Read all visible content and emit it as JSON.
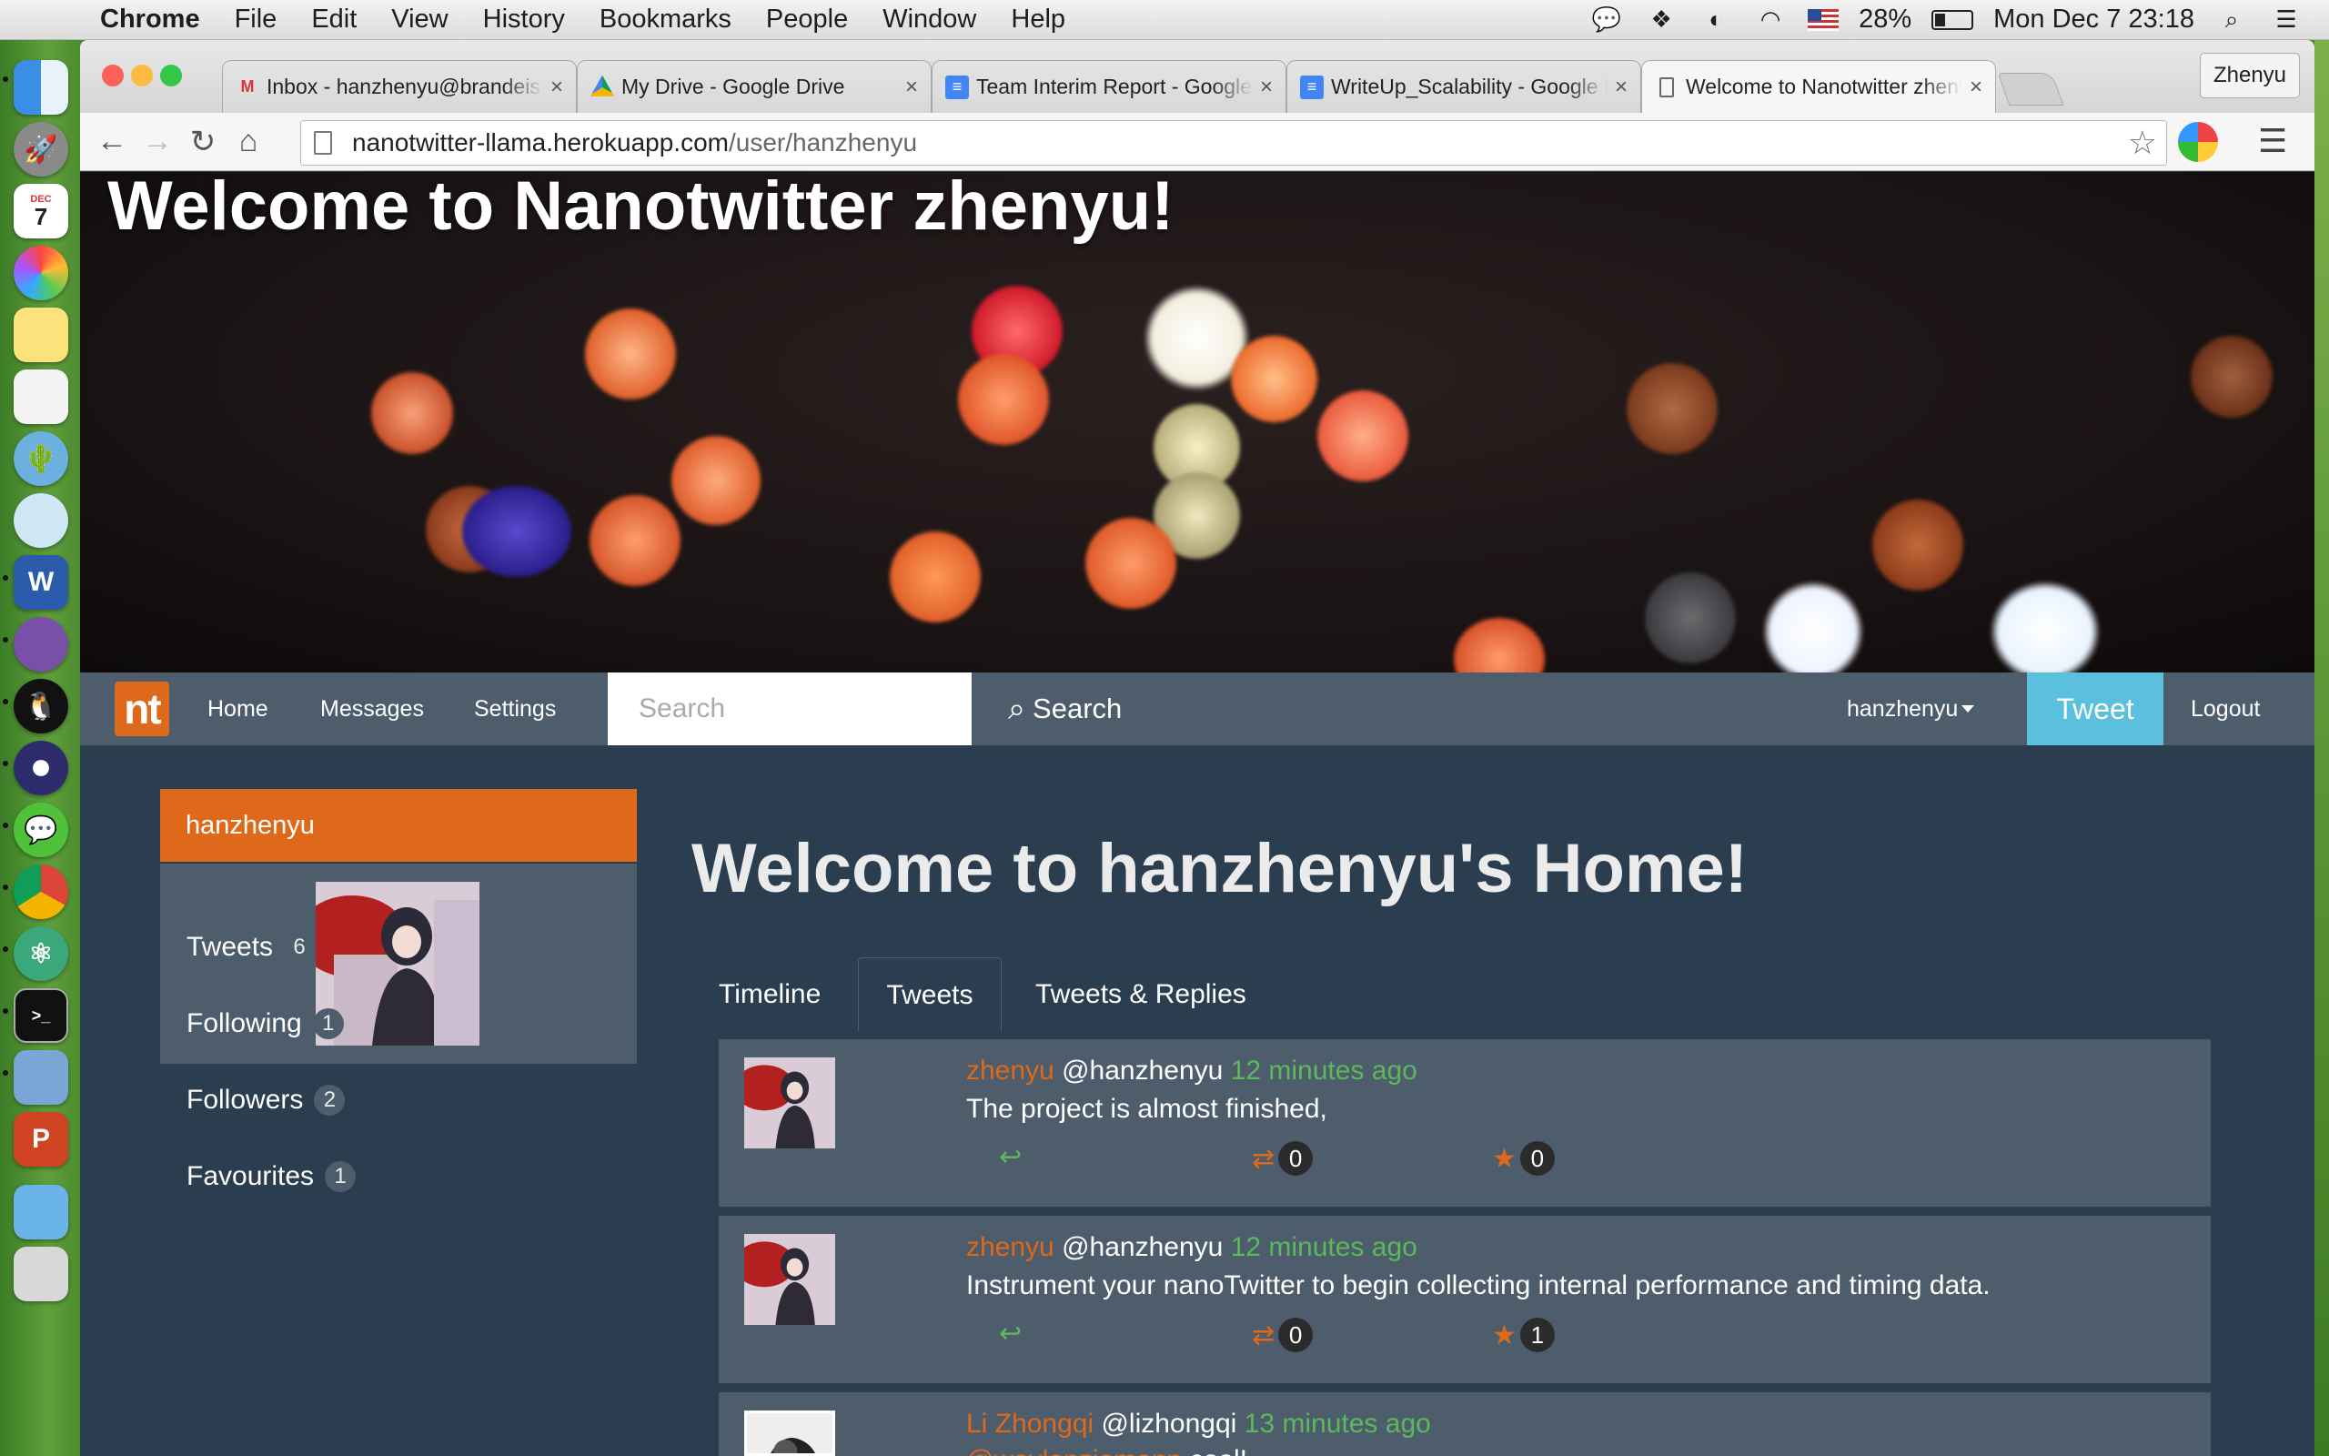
{
  "menubar": {
    "app_name": "Chrome",
    "items": [
      "File",
      "Edit",
      "View",
      "History",
      "Bookmarks",
      "People",
      "Window",
      "Help"
    ],
    "battery_percent": "28%",
    "clock": "Mon Dec 7  23:18"
  },
  "dock": {
    "calendar_month": "DEC",
    "calendar_day": "7"
  },
  "browser": {
    "tabs": [
      {
        "title": "Inbox - hanzhenyu@brandeis.edu",
        "icon": "gmail-icon"
      },
      {
        "title": "My Drive - Google Drive",
        "icon": "google-drive-icon"
      },
      {
        "title": "Team Interim Report - Google Docs",
        "icon": "google-docs-icon"
      },
      {
        "title": "WriteUp_Scalability - Google Docs",
        "icon": "google-docs-icon"
      },
      {
        "title": "Welcome to Nanotwitter zhenyu!",
        "icon": "page-icon"
      }
    ],
    "profile_name": "Zhenyu",
    "url_host": "nanotwitter-llama.herokuapp.com",
    "url_path": "/user/hanzhenyu"
  },
  "hero": {
    "title": "Welcome to Nanotwitter zhenyu!"
  },
  "navbar": {
    "logo": "nt",
    "home": "Home",
    "messages": "Messages",
    "settings": "Settings",
    "search_placeholder": "Search",
    "search_button": "Search",
    "user_menu": "hanzhenyu",
    "tweet_button": "Tweet",
    "logout": "Logout"
  },
  "sidebar": {
    "username": "hanzhenyu",
    "stats": [
      {
        "label": "Tweets",
        "count": "6"
      },
      {
        "label": "Following",
        "count": "1"
      },
      {
        "label": "Followers",
        "count": "2"
      },
      {
        "label": "Favourites",
        "count": "1"
      }
    ]
  },
  "main": {
    "title": "Welcome to hanzhenyu's Home!",
    "tabs": [
      "Timeline",
      "Tweets",
      "Tweets & Replies"
    ],
    "active_tab": "Tweets",
    "tweets": [
      {
        "name": "zhenyu",
        "handle": "@hanzhenyu",
        "time": "12 minutes ago",
        "text": "The project is almost finished,",
        "mention": "",
        "retweets": "0",
        "favorites": "0"
      },
      {
        "name": "zhenyu",
        "handle": "@hanzhenyu",
        "time": "12 minutes ago",
        "text": "Instrument your nanoTwitter to begin collecting internal performance and timing data.",
        "mention": "",
        "retweets": "0",
        "favorites": "1"
      },
      {
        "name": "Li Zhongqi",
        "handle": "@lizhongqi",
        "time": "13 minutes ago",
        "text": " cool!",
        "mention": "@waylonziemann",
        "retweets": "",
        "favorites": ""
      }
    ]
  },
  "colors": {
    "accent_orange": "#df691a",
    "accent_green": "#5cb85c",
    "tweet_blue": "#5bc0de",
    "page_bg": "#2b3e50",
    "panel_bg": "#4e5d6c"
  }
}
